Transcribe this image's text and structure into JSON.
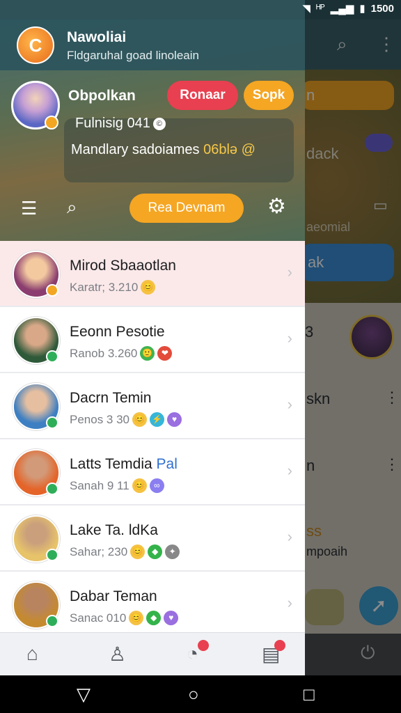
{
  "status_bar": {
    "net": "ᴴᴾ",
    "time": "1500"
  },
  "drawer": {
    "app_title": "Nawoliai",
    "app_subtitle": "Fldgaruhal  goad linoleain",
    "app_logo_letter": "C",
    "profile": {
      "name": "Obpolkan",
      "status": "Fulnisig 041",
      "status_icon": "©"
    },
    "buttons": {
      "red": "Ronaar",
      "orange_small": "Sopk",
      "orange_large": "Rea Devnam"
    },
    "info": {
      "text": "Mandlary sadoiames ",
      "highlight": "06blə @"
    },
    "contacts": [
      {
        "name": "Mirod Sbaaotlan",
        "name_accent": "",
        "sub": "Karatr; 3.210",
        "emojis": [
          "😊"
        ],
        "badge_color": "#f2a623",
        "avatar_colors": [
          "#f3c9a0",
          "#8a3d6e"
        ]
      },
      {
        "name": "Eeonn Pesotie",
        "name_accent": "",
        "sub": "Ranob 3.260",
        "emojis": [
          "🙂",
          "❤"
        ],
        "badge_color": "#2fae5a",
        "avatar_colors": [
          "#d8a888",
          "#2f5a3a"
        ]
      },
      {
        "name": "Dacrn Temin",
        "name_accent": "",
        "sub": "Penos 3 30",
        "emojis": [
          "😊",
          "⚡",
          "♥"
        ],
        "badge_color": "#2fae5a",
        "avatar_colors": [
          "#e6bfa0",
          "#3d7fc2"
        ]
      },
      {
        "name": "Latts Temdia ",
        "name_accent": "Pal",
        "sub": "Sanah 9 11",
        "emojis": [
          "😊",
          "∞"
        ],
        "badge_color": "#2fae5a",
        "avatar_colors": [
          "#d29a78",
          "#e4642a"
        ]
      },
      {
        "name": "Lake Ta. ldKa",
        "name_accent": "",
        "sub": "Sahar; 230",
        "emojis": [
          "😊",
          "◆",
          "✦"
        ],
        "badge_color": "#2fae5a",
        "avatar_colors": [
          "#caa07c",
          "#e7c36a"
        ]
      },
      {
        "name": "Dabar Teman",
        "name_accent": "",
        "sub": "Sanac 010",
        "emojis": [
          "😊",
          "◆",
          "♥"
        ],
        "badge_color": "#2fae5a",
        "avatar_colors": [
          "#b88460",
          "#c58a30"
        ]
      }
    ]
  },
  "background_app": {
    "pill_yellow": "n",
    "text_dack": "dack",
    "text_saeomial": "aeomial",
    "pill_blue": "ak",
    "text_3": "3",
    "text_skn": "skn",
    "text_n": "n",
    "text_ss": "ss",
    "text_mpoaih": "mpoaih"
  },
  "colors": {
    "accent_red": "#e84050",
    "accent_orange": "#f5a623",
    "drawer_header": "#2d555c"
  }
}
